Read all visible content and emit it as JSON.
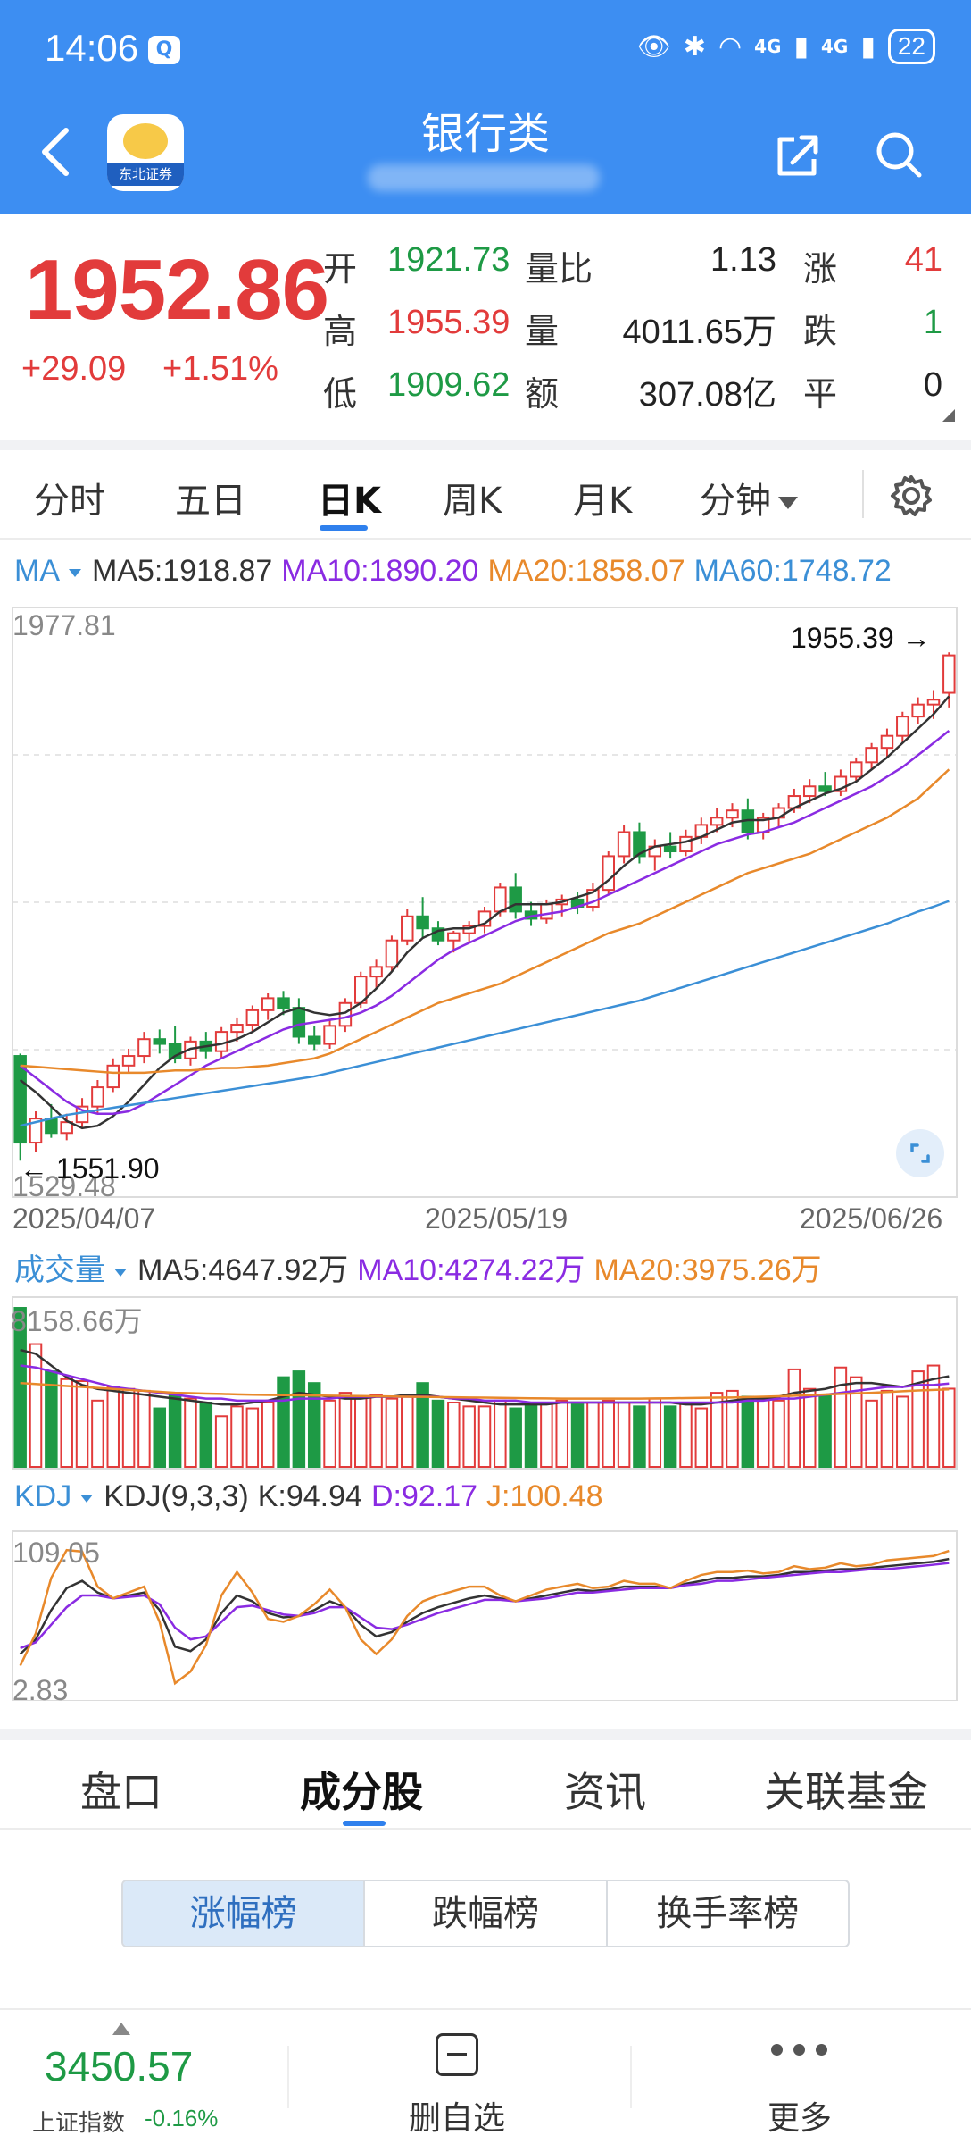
{
  "status_bar": {
    "time": "14:06",
    "signal_1": "4G",
    "signal_2": "4G",
    "battery": "22"
  },
  "header": {
    "title": "银行类",
    "app_logo_text": "东北证券"
  },
  "quote": {
    "price": "1952.86",
    "change": "+29.09",
    "change_pct": "+1.51%",
    "open_label": "开",
    "open": "1921.73",
    "high_label": "高",
    "high": "1955.39",
    "low_label": "低",
    "low": "1909.62",
    "vol_ratio_label": "量比",
    "vol_ratio": "1.13",
    "volume_label": "量",
    "volume": "4011.65万",
    "amount_label": "额",
    "amount": "307.08亿",
    "up_label": "涨",
    "up": "41",
    "down_label": "跌",
    "down": "1",
    "flat_label": "平",
    "flat": "0"
  },
  "period_tabs": [
    "分时",
    "五日",
    "日K",
    "周K",
    "月K",
    "分钟"
  ],
  "kline": {
    "ma_label": "MA",
    "ma5": "MA5:1918.87",
    "ma10": "MA10:1890.20",
    "ma20": "MA20:1858.07",
    "ma60": "MA60:1748.72",
    "axis_max": "1977.81",
    "axis_min": "1529.48",
    "high_callout": "1955.39",
    "low_callout": "1551.90",
    "dates": [
      "2025/04/07",
      "2025/05/19",
      "2025/06/26"
    ]
  },
  "volume_panel": {
    "label": "成交量",
    "ma5": "MA5:4647.92万",
    "ma10": "MA10:4274.22万",
    "ma20": "MA20:3975.26万",
    "axis_max": "8158.66万"
  },
  "kdj_panel": {
    "label": "KDJ",
    "params": "KDJ(9,3,3)",
    "k": "K:94.94",
    "d": "D:92.17",
    "j": "J:100.48",
    "axis_max": "109.05",
    "axis_min": "2.83"
  },
  "bottom_tabs": [
    "盘口",
    "成分股",
    "资讯",
    "关联基金"
  ],
  "rank_tabs": [
    "涨幅榜",
    "跌幅榜",
    "换手率榜"
  ],
  "bottom_bar": {
    "index_value": "3450.57",
    "index_name": "上证指数",
    "index_change": "-0.16%",
    "delete_watch": "删自选",
    "more": "更多"
  },
  "colors": {
    "rise": "#e23b3b",
    "fall": "#1e9a45",
    "header": "#3d8ef2",
    "ma5": "#333333",
    "ma10": "#8a2be2",
    "ma20": "#e8892b",
    "ma60": "#3b8fd6"
  },
  "chart_data": {
    "type": "candlestick",
    "title": "银行类",
    "x_start": "2025/04/07",
    "x_mid": "2025/05/19",
    "x_end": "2025/06/26",
    "ylim": [
      1529.48,
      1977.81
    ],
    "candles": [
      [
        1620,
        1622,
        1533,
        1548
      ],
      [
        1548,
        1574,
        1540,
        1568
      ],
      [
        1568,
        1580,
        1552,
        1556
      ],
      [
        1556,
        1572,
        1550,
        1565
      ],
      [
        1565,
        1585,
        1560,
        1578
      ],
      [
        1578,
        1600,
        1572,
        1594
      ],
      [
        1594,
        1618,
        1590,
        1612
      ],
      [
        1612,
        1626,
        1606,
        1620
      ],
      [
        1620,
        1640,
        1614,
        1634
      ],
      [
        1634,
        1642,
        1622,
        1630
      ],
      [
        1630,
        1645,
        1614,
        1618
      ],
      [
        1618,
        1636,
        1612,
        1632
      ],
      [
        1632,
        1640,
        1618,
        1624
      ],
      [
        1624,
        1644,
        1618,
        1640
      ],
      [
        1640,
        1652,
        1632,
        1646
      ],
      [
        1646,
        1662,
        1640,
        1658
      ],
      [
        1658,
        1672,
        1650,
        1668
      ],
      [
        1668,
        1674,
        1654,
        1660
      ],
      [
        1660,
        1668,
        1630,
        1636
      ],
      [
        1636,
        1645,
        1625,
        1630
      ],
      [
        1630,
        1650,
        1626,
        1645
      ],
      [
        1645,
        1668,
        1640,
        1664
      ],
      [
        1664,
        1690,
        1660,
        1686
      ],
      [
        1686,
        1700,
        1676,
        1694
      ],
      [
        1694,
        1720,
        1690,
        1716
      ],
      [
        1716,
        1742,
        1712,
        1736
      ],
      [
        1736,
        1752,
        1718,
        1726
      ],
      [
        1726,
        1732,
        1712,
        1716
      ],
      [
        1716,
        1724,
        1706,
        1722
      ],
      [
        1722,
        1732,
        1714,
        1728
      ],
      [
        1728,
        1744,
        1722,
        1740
      ],
      [
        1740,
        1764,
        1736,
        1760
      ],
      [
        1760,
        1772,
        1734,
        1740
      ],
      [
        1740,
        1748,
        1728,
        1734
      ],
      [
        1734,
        1750,
        1730,
        1746
      ],
      [
        1746,
        1754,
        1736,
        1750
      ],
      [
        1750,
        1756,
        1738,
        1744
      ],
      [
        1744,
        1764,
        1740,
        1758
      ],
      [
        1758,
        1790,
        1754,
        1786
      ],
      [
        1786,
        1812,
        1780,
        1806
      ],
      [
        1806,
        1814,
        1780,
        1786
      ],
      [
        1786,
        1800,
        1774,
        1794
      ],
      [
        1794,
        1806,
        1784,
        1790
      ],
      [
        1790,
        1808,
        1786,
        1802
      ],
      [
        1802,
        1818,
        1796,
        1812
      ],
      [
        1812,
        1826,
        1806,
        1818
      ],
      [
        1818,
        1830,
        1810,
        1824
      ],
      [
        1824,
        1834,
        1800,
        1806
      ],
      [
        1806,
        1822,
        1800,
        1818
      ],
      [
        1818,
        1830,
        1810,
        1826
      ],
      [
        1826,
        1842,
        1822,
        1836
      ],
      [
        1836,
        1850,
        1830,
        1844
      ],
      [
        1844,
        1856,
        1836,
        1840
      ],
      [
        1840,
        1858,
        1836,
        1852
      ],
      [
        1852,
        1868,
        1848,
        1864
      ],
      [
        1864,
        1880,
        1858,
        1876
      ],
      [
        1876,
        1892,
        1868,
        1886
      ],
      [
        1886,
        1906,
        1880,
        1902
      ],
      [
        1902,
        1918,
        1896,
        1912
      ],
      [
        1912,
        1924,
        1900,
        1916
      ],
      [
        1921.73,
        1955.39,
        1909.62,
        1952.86
      ]
    ],
    "ma_series": [
      {
        "name": "MA5",
        "values": [
          1600,
          1590,
          1578,
          1566,
          1560,
          1562,
          1570,
          1582,
          1596,
          1610,
          1620,
          1626,
          1628,
          1630,
          1634,
          1640,
          1648,
          1656,
          1660,
          1656,
          1654,
          1656,
          1664,
          1676,
          1690,
          1706,
          1718,
          1724,
          1726,
          1726,
          1730,
          1740,
          1746,
          1746,
          1746,
          1748,
          1752,
          1756,
          1766,
          1778,
          1788,
          1794,
          1796,
          1798,
          1802,
          1808,
          1814,
          1816,
          1816,
          1818,
          1826,
          1832,
          1838,
          1842,
          1848,
          1858,
          1868,
          1880,
          1892,
          1904,
          1918.87
        ]
      },
      {
        "name": "MA10",
        "values": [
          1612,
          1602,
          1592,
          1582,
          1575,
          1572,
          1572,
          1574,
          1580,
          1588,
          1596,
          1604,
          1612,
          1618,
          1624,
          1630,
          1636,
          1642,
          1646,
          1648,
          1650,
          1652,
          1656,
          1662,
          1670,
          1680,
          1690,
          1700,
          1708,
          1714,
          1720,
          1726,
          1732,
          1736,
          1738,
          1740,
          1744,
          1748,
          1754,
          1760,
          1766,
          1772,
          1778,
          1784,
          1790,
          1796,
          1800,
          1804,
          1806,
          1810,
          1814,
          1820,
          1826,
          1832,
          1838,
          1844,
          1852,
          1860,
          1870,
          1880,
          1890.2
        ]
      },
      {
        "name": "MA20",
        "values": [
          1612,
          1611,
          1610,
          1609,
          1608,
          1607,
          1606,
          1606,
          1606,
          1607,
          1608,
          1608,
          1609,
          1610,
          1610,
          1611,
          1612,
          1614,
          1616,
          1618,
          1622,
          1628,
          1634,
          1640,
          1646,
          1652,
          1658,
          1664,
          1668,
          1672,
          1676,
          1680,
          1686,
          1692,
          1698,
          1704,
          1710,
          1716,
          1722,
          1726,
          1730,
          1736,
          1742,
          1748,
          1754,
          1760,
          1766,
          1772,
          1776,
          1780,
          1784,
          1788,
          1794,
          1800,
          1806,
          1812,
          1818,
          1826,
          1834,
          1846,
          1858.07
        ]
      },
      {
        "name": "MA60",
        "values": [
          1562,
          1565,
          1568,
          1571,
          1573,
          1575,
          1577,
          1579,
          1581,
          1583,
          1585,
          1587,
          1589,
          1591,
          1593,
          1595,
          1597,
          1599,
          1601,
          1603,
          1606,
          1609,
          1612,
          1615,
          1618,
          1621,
          1624,
          1627,
          1630,
          1633,
          1636,
          1639,
          1642,
          1645,
          1648,
          1651,
          1654,
          1657,
          1660,
          1663,
          1666,
          1670,
          1674,
          1678,
          1682,
          1686,
          1690,
          1694,
          1698,
          1702,
          1706,
          1710,
          1714,
          1718,
          1722,
          1726,
          1730,
          1735,
          1740,
          1744,
          1748.72
        ]
      }
    ],
    "volume": {
      "ylim": [
        0,
        8158.66
      ],
      "values": [
        8158,
        6300,
        4900,
        4500,
        4400,
        3400,
        4100,
        4000,
        3900,
        3000,
        3700,
        3500,
        3300,
        2600,
        3100,
        3000,
        3300,
        4600,
        4900,
        4300,
        3400,
        3800,
        3600,
        3700,
        3500,
        3600,
        4300,
        3400,
        3300,
        3100,
        3100,
        3400,
        3000,
        3200,
        3300,
        3400,
        3200,
        3300,
        3400,
        3300,
        3100,
        3500,
        3100,
        3300,
        3000,
        3800,
        3900,
        3600,
        3500,
        3400,
        5000,
        4000,
        3700,
        5100,
        4600,
        3400,
        3900,
        3600,
        4900,
        5200,
        4011.65
      ],
      "ma_series": [
        {
          "name": "MA5",
          "values": [
            6000,
            5800,
            5200,
            4600,
            4200,
            4000,
            3900,
            3800,
            3700,
            3600,
            3500,
            3400,
            3300,
            3200,
            3200,
            3300,
            3400,
            3600,
            3800,
            3700,
            3600,
            3500,
            3500,
            3600,
            3600,
            3700,
            3700,
            3600,
            3500,
            3400,
            3300,
            3200,
            3200,
            3200,
            3200,
            3300,
            3300,
            3300,
            3300,
            3300,
            3300,
            3300,
            3300,
            3200,
            3200,
            3300,
            3400,
            3500,
            3500,
            3600,
            3800,
            3900,
            4000,
            4200,
            4300,
            4300,
            4200,
            4100,
            4300,
            4500,
            4647.92
          ]
        },
        {
          "name": "MA10",
          "values": [
            5200,
            5100,
            4900,
            4700,
            4500,
            4300,
            4100,
            4000,
            3900,
            3800,
            3700,
            3600,
            3500,
            3500,
            3400,
            3400,
            3400,
            3400,
            3500,
            3500,
            3500,
            3600,
            3600,
            3600,
            3600,
            3600,
            3600,
            3600,
            3500,
            3500,
            3400,
            3400,
            3400,
            3300,
            3300,
            3300,
            3300,
            3300,
            3300,
            3300,
            3300,
            3300,
            3300,
            3300,
            3300,
            3300,
            3300,
            3400,
            3400,
            3500,
            3500,
            3600,
            3700,
            3800,
            3900,
            4000,
            4100,
            4100,
            4200,
            4200,
            4274.22
          ]
        },
        {
          "name": "MA20",
          "values": [
            4300,
            4250,
            4200,
            4150,
            4100,
            4050,
            4000,
            3950,
            3900,
            3850,
            3800,
            3780,
            3760,
            3740,
            3720,
            3700,
            3690,
            3680,
            3670,
            3660,
            3650,
            3640,
            3630,
            3620,
            3610,
            3600,
            3590,
            3580,
            3570,
            3560,
            3550,
            3540,
            3530,
            3520,
            3510,
            3500,
            3500,
            3500,
            3500,
            3500,
            3500,
            3510,
            3520,
            3530,
            3540,
            3550,
            3560,
            3580,
            3600,
            3620,
            3650,
            3680,
            3710,
            3740,
            3770,
            3800,
            3840,
            3880,
            3920,
            3950,
            3975.26
          ]
        }
      ]
    },
    "kdj": {
      "ylim": [
        2.83,
        109.05
      ],
      "K": [
        30,
        40,
        60,
        75,
        80,
        72,
        68,
        70,
        72,
        60,
        35,
        32,
        40,
        58,
        70,
        66,
        58,
        55,
        56,
        60,
        66,
        62,
        50,
        42,
        45,
        52,
        58,
        62,
        65,
        68,
        70,
        68,
        66,
        68,
        70,
        72,
        74,
        73,
        74,
        76,
        76,
        76,
        75,
        78,
        80,
        82,
        82,
        83,
        83,
        84,
        86,
        86,
        87,
        88,
        88,
        89,
        90,
        91,
        92,
        93,
        94.94
      ],
      "D": [
        34,
        38,
        50,
        62,
        70,
        70,
        68,
        69,
        70,
        64,
        48,
        40,
        42,
        52,
        62,
        63,
        60,
        57,
        56,
        58,
        62,
        62,
        55,
        48,
        47,
        50,
        54,
        58,
        61,
        64,
        67,
        67,
        66,
        67,
        68,
        70,
        72,
        72,
        73,
        74,
        75,
        75,
        75,
        77,
        78,
        80,
        80,
        81,
        82,
        83,
        84,
        85,
        86,
        86,
        87,
        88,
        88,
        89,
        90,
        91,
        92.17
      ],
      "J": [
        22,
        44,
        82,
        101,
        100,
        76,
        68,
        72,
        76,
        52,
        10,
        18,
        36,
        70,
        86,
        72,
        54,
        52,
        56,
        64,
        74,
        62,
        40,
        30,
        40,
        56,
        66,
        70,
        73,
        76,
        76,
        70,
        66,
        70,
        74,
        76,
        78,
        75,
        76,
        80,
        78,
        78,
        75,
        80,
        84,
        86,
        86,
        87,
        85,
        86,
        90,
        88,
        89,
        92,
        90,
        91,
        94,
        95,
        96,
        97,
        100.48
      ]
    }
  }
}
